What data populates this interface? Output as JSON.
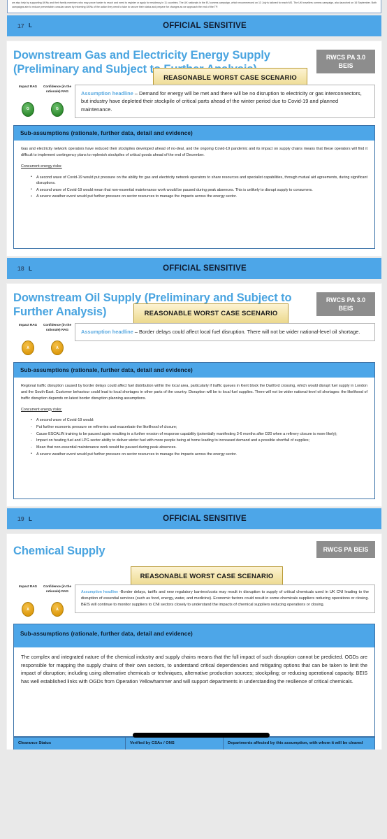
{
  "document": {
    "classification_banner": "OFFICIAL SENSITIVE",
    "top_fragment_text": "we also help by supporting UKNs and their family members who may prove harder to reach and need to register or apply for residency in 11 countries. The UK nationals in the EU comms campaign, which recommenced on 13 July is tailored for each MS. The UK travellers comms campaign, also launched on 16 September. Both campaigns aim to reduce preventable consular cases by informing UKNs of the action they need to take to secure their status and prepare for changes as we approach the end of the TP."
  },
  "banners": [
    {
      "page_number": "17",
      "mark": "L",
      "title": "OFFICIAL SENSITIVE"
    },
    {
      "page_number": "18",
      "mark": "L",
      "title": "OFFICIAL SENSITIVE"
    },
    {
      "page_number": "19",
      "mark": "L",
      "title": "OFFICIAL SENSITIVE"
    }
  ],
  "rag_labels": {
    "impact": "Impact RAG",
    "confidence": "Confidence (in the rationale) RAG"
  },
  "scenario_banner_label": "REASONABLE WORST CASE SCENARIO",
  "sub_assumptions_header": "Sub-assumptions (rationale, further data, detail and evidence)",
  "assumption_headline_label": "Assumption headline",
  "slides": [
    {
      "title": "Downstream Gas and Electricity Energy Supply (Preliminary and Subject to Further Analysis)",
      "owner_badge": "RWCS PA 3.0 BEIS",
      "impact_rag": "G",
      "impact_rag_color": "#2e8b2e",
      "confidence_rag": "G",
      "confidence_rag_color": "#2e8b2e",
      "headline": "– Demand for energy will be met and there will be no disruption to electricity or gas interconnectors, but industry have depleted their stockpile of critical parts ahead of the winter period due to Covid-19 and planned maintenance.",
      "body": "Gas and electricity network operators have reduced their stockpiles developed ahead of no-deal, and the ongoing Covid-19 pandemic and its impact on supply chains means that these operators will find it difficult to implement contingency plans to replenish stockpiles of critical goods ahead of the end of December.",
      "risks_title": "Concurrent energy risks:",
      "risks": [
        {
          "kind": "bullet",
          "text": "A second wave of Covid-19 would put pressure on the ability for gas and electricity network operators to share resources and specialist capabilities, through mutual aid agreements, during significant disruptions."
        },
        {
          "kind": "bullet",
          "text": "A second wave of Covid-19 would mean that non-essential maintenance work would be paused during peak absences. This is unlikely to disrupt supply to consumers."
        },
        {
          "kind": "bullet",
          "text": "A severe weather event would put further pressure on sector resources to manage the impacts across the energy sector."
        }
      ]
    },
    {
      "title": "Downstream Oil Supply (Preliminary and Subject to Further Analysis)",
      "owner_badge": "RWCS PA 3.0 BEIS",
      "impact_rag": "A",
      "impact_rag_color": "#dd9a0e",
      "confidence_rag": "A",
      "confidence_rag_color": "#dd9a0e",
      "headline": "– Border delays could affect local fuel disruption. There will not be wider national-level oil shortage.",
      "body": "Regional traffic disruption caused by border delays could affect fuel distribution within the local area, particularly if traffic queues in Kent block the Dartford crossing, which would disrupt fuel supply in London and the South-East. Customer behaviour could lead to local shortages in other parts of the country. Disruption will be to local fuel supplies. There will not be wider national-level oil shortages: the likelihood of traffic disruption depends on latest border disruption planning assumptions.",
      "risks_title": "Concurrent energy risks:",
      "risks": [
        {
          "kind": "bullet",
          "text": "A second wave of Covid-19 would:"
        },
        {
          "kind": "dash",
          "text": "Put further economic pressure on refineries and exacerbate the likelihood of closure;"
        },
        {
          "kind": "dash",
          "text": "Cause ESCALIN training to be paused again resulting in a further erosion of response capability (potentially manifesting 3-6 months after D20 when a refinery closure is more likely);"
        },
        {
          "kind": "dash",
          "text": "Impact on heating fuel and LPG sector ability to deliver winter fuel with more people being at home leading to increased demand and a possible shortfall of supplies;"
        },
        {
          "kind": "dash",
          "text": "Mean that non-essential maintenance work would be paused during peak absences."
        },
        {
          "kind": "bullet",
          "text": "A severe weather event would put further pressure on sector resources to manage the impacts across the energy sector."
        }
      ]
    },
    {
      "title": "Chemical Supply",
      "owner_badge": "RWCS PA BEIS",
      "impact_rag": "A",
      "impact_rag_color": "#dd9a0e",
      "confidence_rag": "A",
      "confidence_rag_color": "#dd9a0e",
      "headline": "-Border delays, tariffs and new regulatory barriers/costs may result in disruption to supply of critical chemicals used in UK CNI leading to the disruption of essential services (such as food, energy, water, and medicine). Economic factors could result in some chemicals suppliers reducing operations or closing. BEIS will continue to monitor suppliers to CNI sectors closely to understand the impacts of chemical suppliers reducing operations or closing.",
      "body": "The complex and integrated nature of the chemical industry and supply chains means that the full impact of such disruption cannot be predicted. OGDs are responsible for mapping the supply chains of their own sectors, to understand critical dependencies and mitigating options that can be taken to limit the impact of disruption; including using alternative chemicals or techniques, alternative production sources; stockpiling; or reducing operational capacity. BEIS has well established links with OGDs from Operation Yellowhammer and will support departments in understanding the resilience of critical chemicals.",
      "risks_title": "",
      "risks": []
    }
  ],
  "footer_table": {
    "columns": [
      "Clearance Status",
      "Verified by CSAs / ONS",
      "Departments affected by this assumption, with whom it will be cleared"
    ]
  },
  "colors": {
    "banner_blue": "#4da6e8",
    "title_blue": "#49a4e0",
    "badge_gray": "#8d8d8d",
    "scenario_gold": "#ecd98d",
    "page_background": "#e9e9e9"
  }
}
